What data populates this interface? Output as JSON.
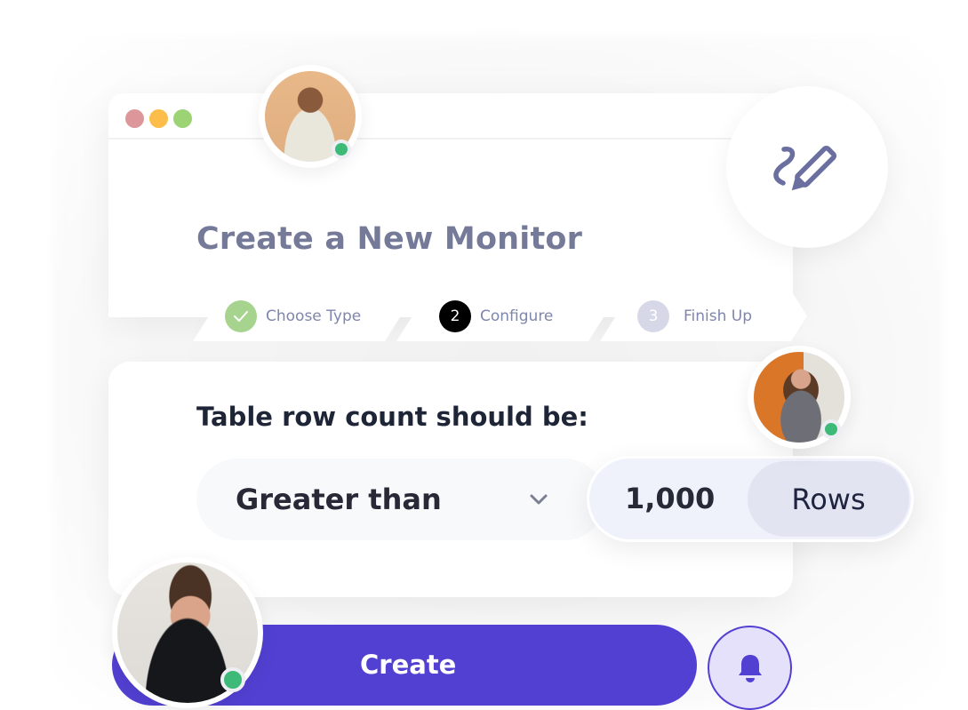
{
  "window": {
    "controls": [
      "close",
      "minimize",
      "maximize"
    ],
    "title": "Create a New Monitor"
  },
  "stepper": {
    "steps": [
      {
        "badge": "✓",
        "label": "Choose Type",
        "state": "completed",
        "color": "#a6d38d"
      },
      {
        "badge": "2",
        "label": "Configure",
        "state": "current",
        "color": "#000000"
      },
      {
        "badge": "3",
        "label": "Finish Up",
        "state": "upcoming",
        "color": "#d6d8e8"
      }
    ]
  },
  "form": {
    "question": "Table row count should be:",
    "comparator": {
      "selected": "Greater than",
      "icon": "chevron-down-icon"
    },
    "threshold": {
      "value": "1,000",
      "unit": "Rows"
    }
  },
  "actions": {
    "create_label": "Create",
    "notify_icon": "bell-icon",
    "accent": "#5240d2"
  },
  "edit_badge": {
    "icon": "signature-pencil-icon",
    "color": "#6a6fa0"
  },
  "collaborators": [
    {
      "name": "collaborator-1",
      "status": "online"
    },
    {
      "name": "collaborator-2",
      "status": "online"
    },
    {
      "name": "collaborator-3",
      "status": "online"
    }
  ],
  "status_color": "#3dba77"
}
